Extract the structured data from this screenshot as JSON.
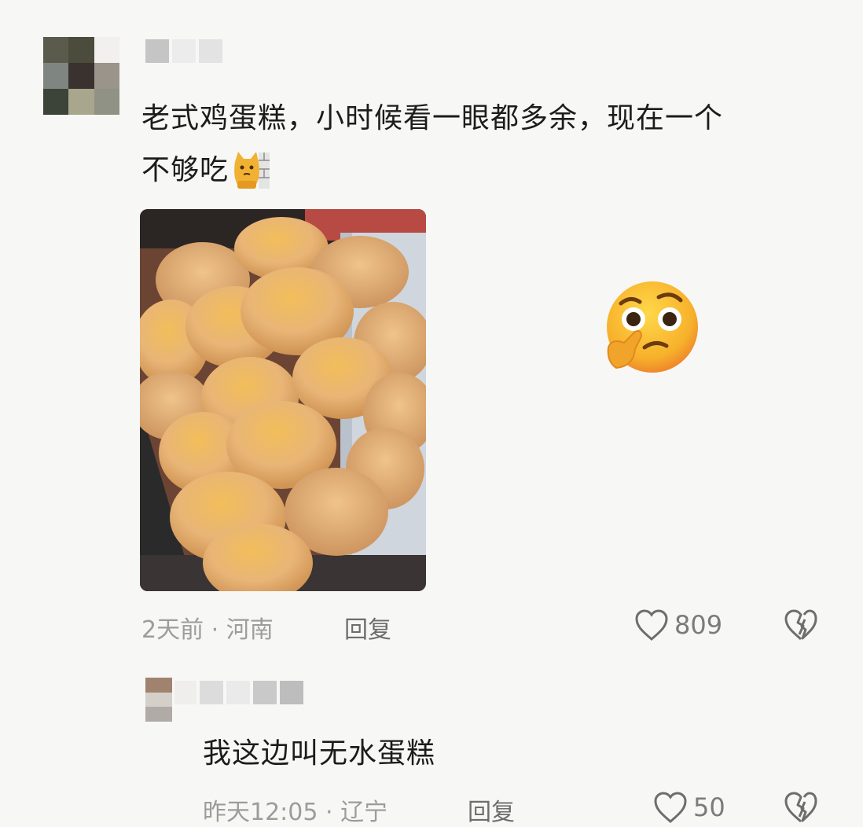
{
  "comment": {
    "text_line1": "老式鸡蛋糕，小时候看一眼都多余，现在一个",
    "text_line2": "不够吃",
    "emoji_inline": "cat-wall-emoji",
    "image": "egg-cakes-photo",
    "sticker": "thinking-face-emoji",
    "time_location": "2天前 · 河南",
    "reply_label": "回复",
    "like_count": "809"
  },
  "reply": {
    "text": "我这边叫无水蛋糕",
    "time_location": "昨天12:05 · 辽宁",
    "reply_label": "回复",
    "like_count": "50"
  },
  "colors": {
    "background": "#f7f7f5",
    "text": "#1c1c1c",
    "meta": "#9c9c9c",
    "reply": "#6d6d6d"
  }
}
